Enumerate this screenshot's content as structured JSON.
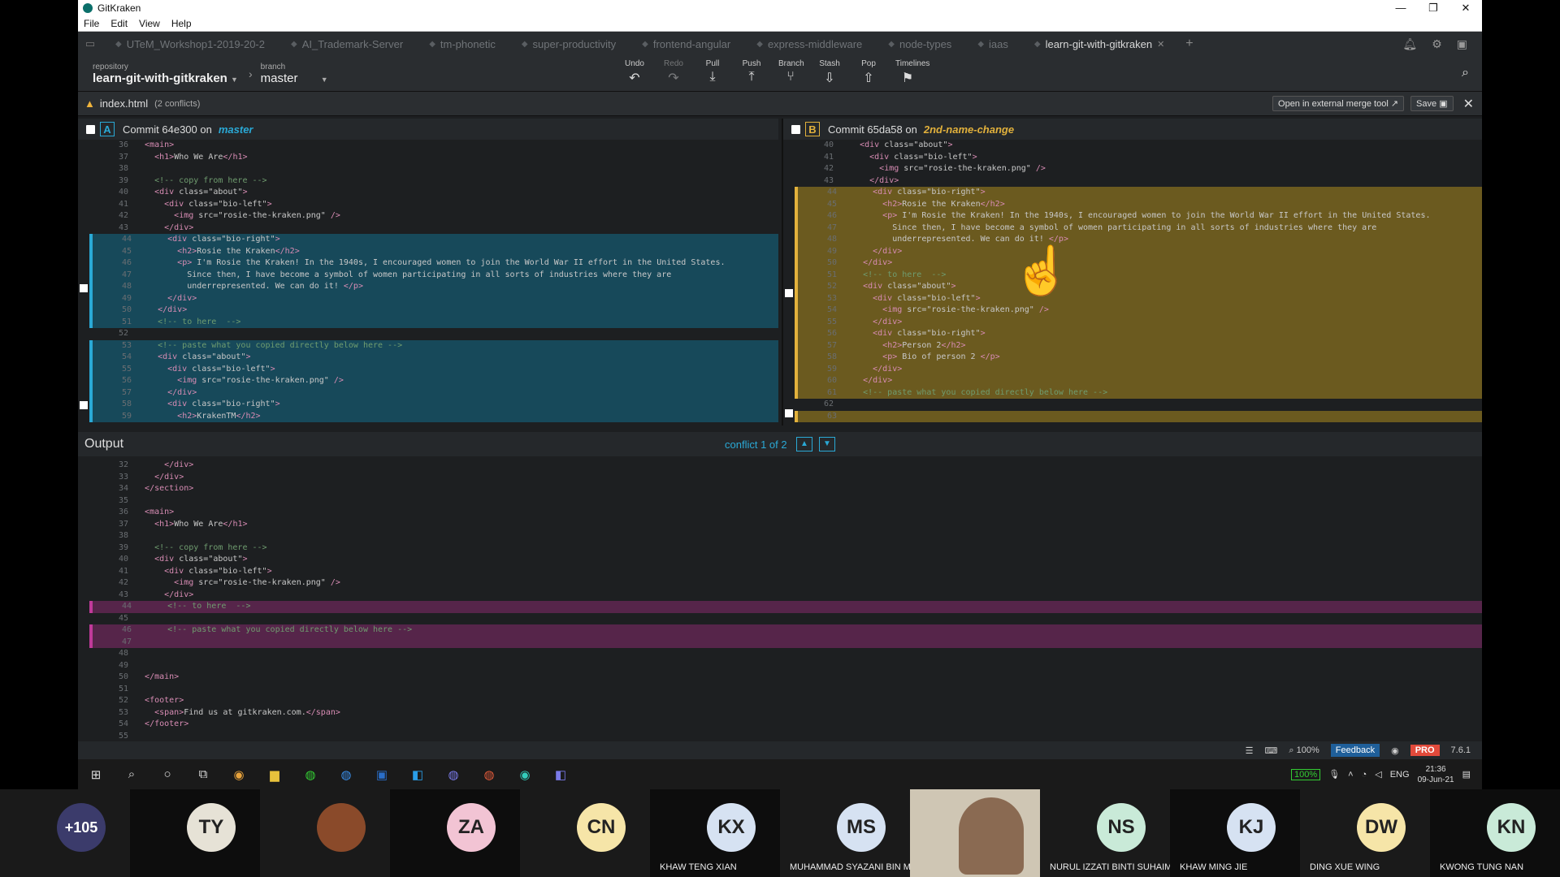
{
  "window": {
    "title": "GitKraken",
    "minimize": "—",
    "restore": "❐",
    "close": "✕"
  },
  "menu": [
    "File",
    "Edit",
    "View",
    "Help"
  ],
  "tabs": [
    {
      "label": "UTeM_Workshop1-2019-20-2"
    },
    {
      "label": "AI_Trademark-Server"
    },
    {
      "label": "tm-phonetic"
    },
    {
      "label": "super-productivity"
    },
    {
      "label": "frontend-angular"
    },
    {
      "label": "express-middleware"
    },
    {
      "label": "node-types"
    },
    {
      "label": "iaas"
    },
    {
      "label": "learn-git-with-gitkraken",
      "active": true
    }
  ],
  "toolbar": {
    "repo_label": "repository",
    "repo_value": "learn-git-with-gitkraken",
    "branch_label": "branch",
    "branch_value": "master",
    "actions": [
      {
        "label": "Undo",
        "icon": "undo-icon",
        "glyph": "↶"
      },
      {
        "label": "Redo",
        "icon": "redo-icon",
        "glyph": "↷",
        "disabled": true
      },
      {
        "label": "Pull",
        "icon": "pull-icon",
        "glyph": "⤓"
      },
      {
        "label": "Push",
        "icon": "push-icon",
        "glyph": "⤒"
      },
      {
        "label": "Branch",
        "icon": "branch-icon",
        "glyph": "⑂"
      },
      {
        "label": "Stash",
        "icon": "stash-icon",
        "glyph": "⇩"
      },
      {
        "label": "Pop",
        "icon": "pop-icon",
        "glyph": "⇧"
      },
      {
        "label": "Timelines",
        "icon": "timelines-icon",
        "glyph": "⚑"
      }
    ]
  },
  "conflict": {
    "file": "index.html",
    "count": "(2 conflicts)",
    "open_external": "Open in external merge tool",
    "save": "Save"
  },
  "paneA": {
    "badge": "A",
    "commit": "Commit 64e300 on",
    "branch": "master",
    "lines": [
      [
        "36",
        "  <main>",
        ""
      ],
      [
        "37",
        "    <h1>Who We Are</h1>",
        ""
      ],
      [
        "38",
        "",
        ""
      ],
      [
        "39",
        "    <!-- copy from here -->",
        ""
      ],
      [
        "40",
        "    <div class=\"about\">",
        ""
      ],
      [
        "41",
        "      <div class=\"bio-left\">",
        ""
      ],
      [
        "42",
        "        <img src=\"rosie-the-kraken.png\" />",
        ""
      ],
      [
        "43",
        "      </div>",
        ""
      ],
      [
        "44",
        "      <div class=\"bio-right\">",
        "a"
      ],
      [
        "45",
        "        <h2>Rosie the Kraken</h2>",
        "a"
      ],
      [
        "46",
        "        <p> I'm Rosie the Kraken! In the 1940s, I encouraged women to join the World War II effort in the United States.",
        "a"
      ],
      [
        "47",
        "          Since then, I have become a symbol of women participating in all sorts of industries where they are",
        "a"
      ],
      [
        "48",
        "          underrepresented. We can do it! </p>",
        "a"
      ],
      [
        "49",
        "      </div>",
        "a"
      ],
      [
        "50",
        "    </div>",
        "a"
      ],
      [
        "51",
        "    <!-- to here  -->",
        "a"
      ],
      [
        "52",
        "",
        ""
      ],
      [
        "53",
        "    <!-- paste what you copied directly below here -->",
        "a"
      ],
      [
        "54",
        "    <div class=\"about\">",
        "a"
      ],
      [
        "55",
        "      <div class=\"bio-left\">",
        "a"
      ],
      [
        "56",
        "        <img src=\"rosie-the-kraken.png\" />",
        "a"
      ],
      [
        "57",
        "      </div>",
        "a"
      ],
      [
        "58",
        "      <div class=\"bio-right\">",
        "a"
      ],
      [
        "59",
        "        <h2>KrakenTM</h2>",
        "a"
      ]
    ]
  },
  "paneB": {
    "badge": "B",
    "commit": "Commit 65da58 on",
    "branch": "2nd-name-change",
    "lines": [
      [
        "40",
        "    <div class=\"about\">",
        ""
      ],
      [
        "41",
        "      <div class=\"bio-left\">",
        ""
      ],
      [
        "42",
        "        <img src=\"rosie-the-kraken.png\" />",
        ""
      ],
      [
        "43",
        "      </div>",
        ""
      ],
      [
        "44",
        "      <div class=\"bio-right\">",
        "b"
      ],
      [
        "45",
        "        <h2>Rosie the Kraken</h2>",
        "b"
      ],
      [
        "46",
        "        <p> I'm Rosie the Kraken! In the 1940s, I encouraged women to join the World War II effort in the United States.",
        "b"
      ],
      [
        "47",
        "          Since then, I have become a symbol of women participating in all sorts of industries where they are",
        "b"
      ],
      [
        "48",
        "          underrepresented. We can do it! </p>",
        "b"
      ],
      [
        "49",
        "      </div>",
        "b"
      ],
      [
        "50",
        "    </div>",
        "b"
      ],
      [
        "51",
        "    <!-- to here  -->",
        "b"
      ],
      [
        "52",
        "    <div class=\"about\">",
        "b"
      ],
      [
        "53",
        "      <div class=\"bio-left\">",
        "b"
      ],
      [
        "54",
        "        <img src=\"rosie-the-kraken.png\" />",
        "b"
      ],
      [
        "55",
        "      </div>",
        "b"
      ],
      [
        "56",
        "      <div class=\"bio-right\">",
        "b"
      ],
      [
        "57",
        "        <h2>Person 2</h2>",
        "b"
      ],
      [
        "58",
        "        <p> Bio of person 2 </p>",
        "b"
      ],
      [
        "59",
        "      </div>",
        "b"
      ],
      [
        "60",
        "    </div>",
        "b"
      ],
      [
        "61",
        "    <!-- paste what you copied directly below here -->",
        "b"
      ],
      [
        "62",
        "",
        ""
      ],
      [
        "63",
        "",
        "b"
      ]
    ]
  },
  "output": {
    "title": "Output",
    "conflict_info": "conflict 1 of 2",
    "prev": "▲",
    "next": "▼",
    "lines": [
      [
        "32",
        "      </div>",
        ""
      ],
      [
        "33",
        "    </div>",
        ""
      ],
      [
        "34",
        "  </section>",
        ""
      ],
      [
        "35",
        "",
        ""
      ],
      [
        "36",
        "  <main>",
        ""
      ],
      [
        "37",
        "    <h1>Who We Are</h1>",
        ""
      ],
      [
        "38",
        "",
        ""
      ],
      [
        "39",
        "    <!-- copy from here -->",
        ""
      ],
      [
        "40",
        "    <div class=\"about\">",
        ""
      ],
      [
        "41",
        "      <div class=\"bio-left\">",
        ""
      ],
      [
        "42",
        "        <img src=\"rosie-the-kraken.png\" />",
        ""
      ],
      [
        "43",
        "      </div>",
        ""
      ],
      [
        "44",
        "      <!-- to here  -->",
        "o"
      ],
      [
        "45",
        "",
        ""
      ],
      [
        "46",
        "      <!-- paste what you copied directly below here -->",
        "o"
      ],
      [
        "47",
        "",
        "o"
      ],
      [
        "48",
        "",
        ""
      ],
      [
        "49",
        "",
        ""
      ],
      [
        "50",
        "  </main>",
        ""
      ],
      [
        "51",
        "",
        ""
      ],
      [
        "52",
        "  <footer>",
        ""
      ],
      [
        "53",
        "    <span>Find us at gitkraken.com.</span>",
        ""
      ],
      [
        "54",
        "  </footer>",
        ""
      ],
      [
        "55",
        "",
        ""
      ]
    ]
  },
  "status": {
    "zoom": "100%",
    "feedback": "Feedback",
    "pro": "PRO",
    "version": "7.6.1"
  },
  "taskbar": {
    "battery": "100%",
    "lang": "ENG",
    "time": "21:36",
    "date": "09-Jun-21"
  },
  "participants": [
    {
      "initials": "+105",
      "name": "",
      "color": "#3b3b6b",
      "text": "#ffffff"
    },
    {
      "initials": "TY",
      "name": "",
      "color": "#e6e2d6",
      "text": "#222222"
    },
    {
      "initials": "",
      "name": "",
      "color": "#8a4a2a",
      "text": "#ffffff",
      "photo": true
    },
    {
      "initials": "ZA",
      "name": "",
      "color": "#f2c4d4",
      "text": "#222222"
    },
    {
      "initials": "CN",
      "name": "",
      "color": "#f6e5a8",
      "text": "#222222"
    },
    {
      "initials": "KX",
      "name": "KHAW TENG XIAN",
      "color": "#d6e2f2",
      "text": "#222222"
    },
    {
      "initials": "MS",
      "name": "MUHAMMAD SYAZANI BIN MOHD...",
      "color": "#d6e2f2",
      "text": "#222222"
    },
    {
      "initials": "",
      "name": "",
      "color": "#cfc6b4",
      "text": "#222222",
      "video": true
    },
    {
      "initials": "NS",
      "name": "NURUL IZZATI BINTI SUHAIMI",
      "color": "#c9ead8",
      "text": "#222222"
    },
    {
      "initials": "KJ",
      "name": "KHAW MING JIE",
      "color": "#d6e2f2",
      "text": "#222222"
    },
    {
      "initials": "DW",
      "name": "DING XUE WING",
      "color": "#f6e5a8",
      "text": "#222222"
    },
    {
      "initials": "KN",
      "name": "KWONG TUNG NAN",
      "color": "#c9ead8",
      "text": "#222222"
    }
  ]
}
